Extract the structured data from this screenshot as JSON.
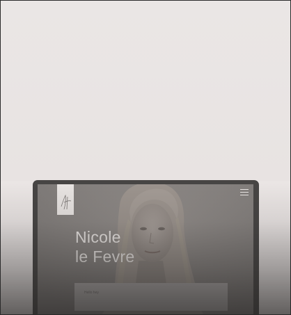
{
  "hero": {
    "first_name": "Nicole",
    "last_name": "le Fevre"
  },
  "cta": {
    "label": "Hello hey"
  },
  "icons": {
    "logo": "signature-logo-icon",
    "menu": "hamburger-menu-icon"
  },
  "colors": {
    "background": "#ebe6e5",
    "device_bezel": "#474544",
    "screen_bg": "#868280",
    "hero_text": "#efebe9",
    "cta_bar": "#b0acab"
  }
}
